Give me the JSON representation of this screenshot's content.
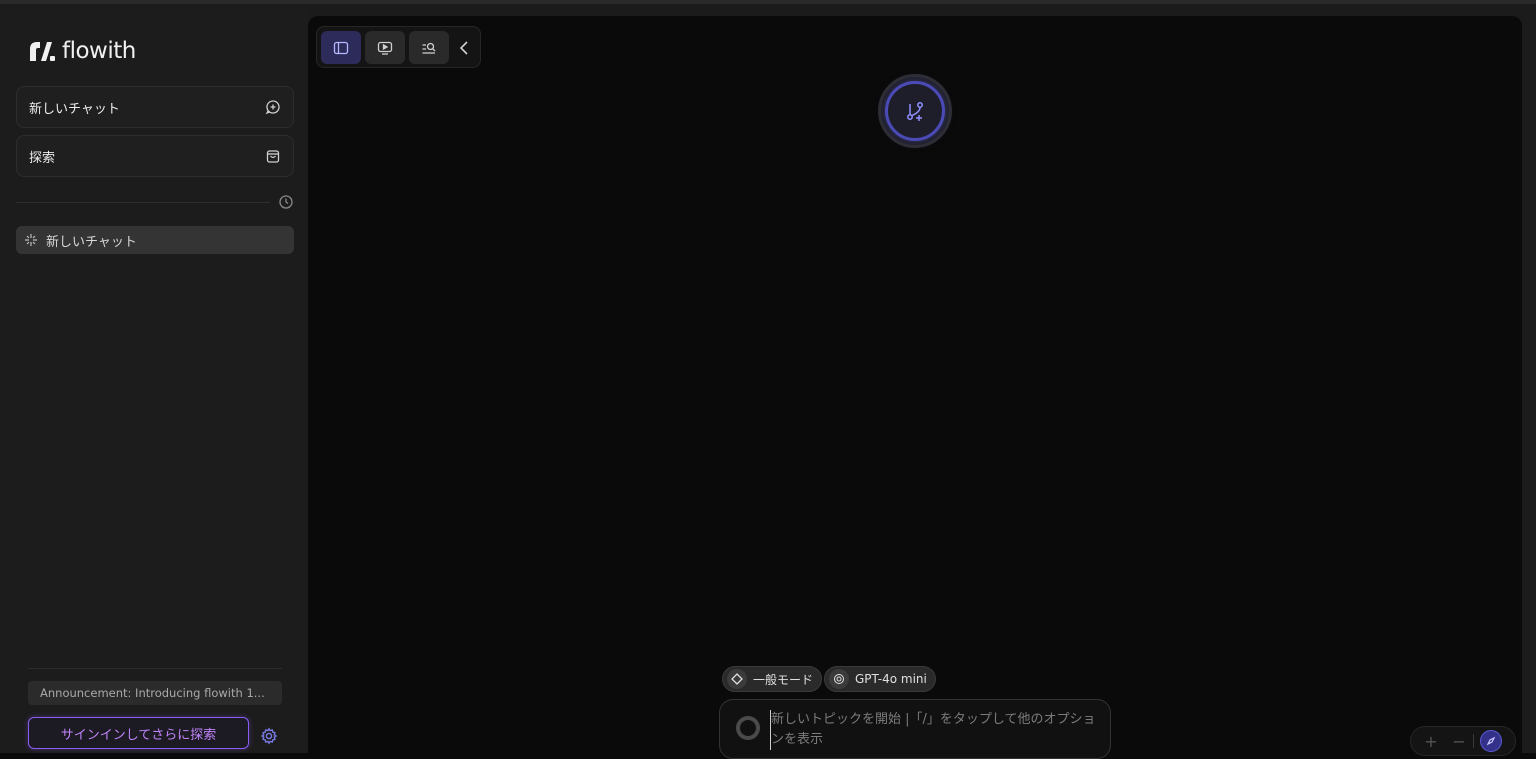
{
  "brand": {
    "name": "flowith"
  },
  "sidebar": {
    "new_chat_label": "新しいチャット",
    "explore_label": "探索",
    "chats": [
      {
        "label": "新しいチャット"
      }
    ],
    "announcement": "Announcement: Introducing flowith 1...",
    "signin_label": "サインインしてさらに探索"
  },
  "chips": {
    "mode_label": "一般モード",
    "model_label": "GPT-4o mini"
  },
  "input": {
    "placeholder": "新しいトピックを開始 |「/」をタップして他のオプションを表示"
  },
  "zoom": {
    "plus": "+",
    "minus": "−"
  },
  "colors": {
    "accent": "#8b5cf6",
    "accent_text": "#c084fc",
    "active_tab": "#2c2b5a",
    "node_ring": "#4b4bb8"
  }
}
